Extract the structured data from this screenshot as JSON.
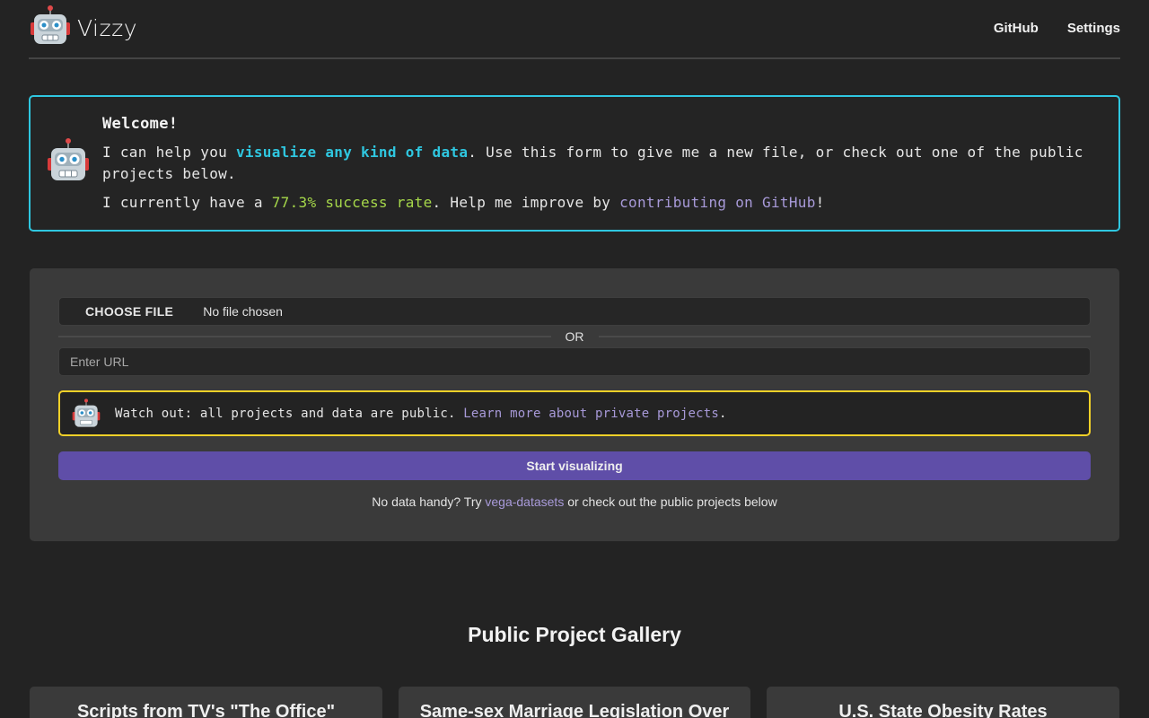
{
  "app": {
    "name": "Vizzy",
    "logo_icon": "robot-icon"
  },
  "nav": {
    "github_label": "GitHub",
    "settings_label": "Settings"
  },
  "welcome": {
    "heading": "Welcome!",
    "line1_pre": "I can help you ",
    "line1_highlight": "visualize any kind of data",
    "line1_post": ". Use this form to give me a new file, or check out one of the public projects below.",
    "line2_pre": "I currently have a ",
    "success_rate_text": "77.3% success rate",
    "line2_mid": ". Help me improve by ",
    "contribute_link": "contributing on GitHub",
    "line2_post": "!",
    "border_color": "#2fc7e0",
    "highlight_color": "#2fc7e0",
    "success_color": "#a6d84a"
  },
  "form": {
    "choose_file_label": "CHOOSE FILE",
    "file_status": "No file chosen",
    "or_label": "OR",
    "url_placeholder": "Enter URL",
    "warning_pre": "Watch out: all projects and data are public. ",
    "warning_link": "Learn more about private projects",
    "warning_post": ".",
    "warning_border_color": "#f3d128",
    "start_label": "Start visualizing",
    "start_color": "#5f4ea8",
    "hint_pre": "No data handy? Try ",
    "hint_link": "vega-datasets",
    "hint_post": " or check out the public projects below"
  },
  "gallery": {
    "title": "Public Project Gallery",
    "cards": [
      {
        "title": "Scripts from TV's \"The Office\""
      },
      {
        "title": "Same-sex Marriage Legislation Over"
      },
      {
        "title": "U.S. State Obesity Rates"
      }
    ]
  }
}
